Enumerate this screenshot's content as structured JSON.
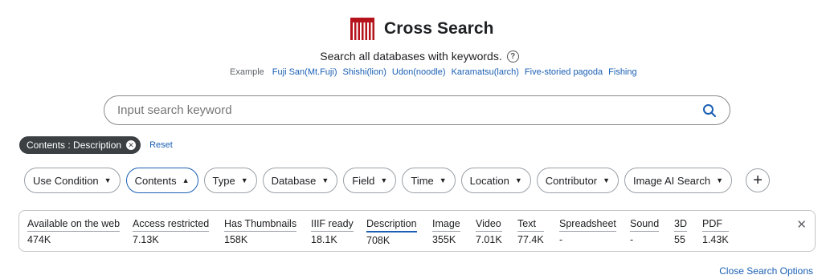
{
  "header": {
    "app_title": "Cross Search",
    "subtitle": "Search all databases with keywords.",
    "help_icon": "question-circle-icon",
    "brand_color": "#b5121b"
  },
  "examples": {
    "label": "Example",
    "items": [
      "Fuji San(Mt.Fuji)",
      "Shishi(lion)",
      "Udon(noodle)",
      "Karamatsu(larch)",
      "Five-storied pagoda",
      "Fishing"
    ]
  },
  "search": {
    "placeholder": "Input search keyword",
    "value": "",
    "button_icon": "search-icon"
  },
  "active_filter": {
    "chip_label": "Contents : Description",
    "reset_label": "Reset"
  },
  "filters": {
    "use_condition": "Use Condition",
    "contents": "Contents",
    "type": "Type",
    "database": "Database",
    "field": "Field",
    "time": "Time",
    "location": "Location",
    "contributor": "Contributor",
    "image_ai_search": "Image AI Search",
    "add_icon": "plus-icon"
  },
  "contents_panel": {
    "items": [
      {
        "label": "Available on the web",
        "value": "474K"
      },
      {
        "label": "Access restricted",
        "value": "7.13K"
      },
      {
        "label": "Has Thumbnails",
        "value": "158K"
      },
      {
        "label": "IIIF ready",
        "value": "18.1K"
      },
      {
        "label": "Description",
        "value": "708K"
      },
      {
        "label": "Image",
        "value": "355K"
      },
      {
        "label": "Video",
        "value": "7.01K"
      },
      {
        "label": "Text",
        "value": "77.4K"
      },
      {
        "label": "Spreadsheet",
        "value": "-"
      },
      {
        "label": "Sound",
        "value": "-"
      },
      {
        "label": "3D",
        "value": "55"
      },
      {
        "label": "PDF",
        "value": "1.43K"
      }
    ],
    "selected": "Description"
  },
  "close_search_options": "Close Search Options",
  "colors": {
    "link": "#1a5fb4",
    "chip_bg": "#3c4043",
    "border": "#9aa0a6"
  }
}
